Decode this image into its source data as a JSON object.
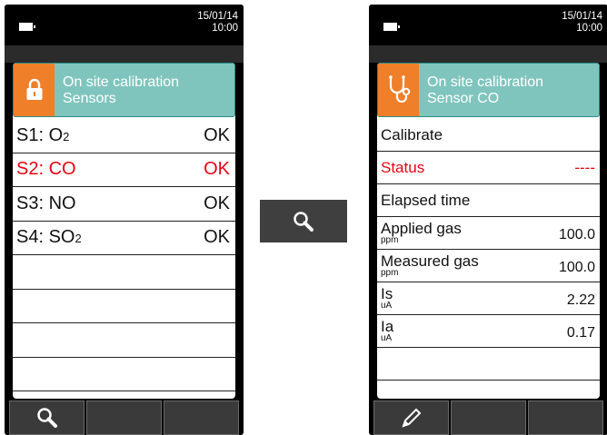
{
  "left_screen": {
    "date": "15/01/14",
    "time": "10:00",
    "header_line1": "On site calibration",
    "header_line2": "Sensors",
    "header_icon": "lock-icon",
    "sensors": [
      {
        "prefix": "S1: O",
        "sub": "2",
        "status": "OK",
        "highlighted": false
      },
      {
        "prefix": "S2: CO",
        "sub": "",
        "status": "OK",
        "highlighted": true
      },
      {
        "prefix": "S3: NO",
        "sub": "",
        "status": "OK",
        "highlighted": false
      },
      {
        "prefix": "S4: SO",
        "sub": "2",
        "status": "OK",
        "highlighted": false
      }
    ],
    "softkey_icons": [
      "search-icon",
      "",
      ""
    ]
  },
  "middle_button": {
    "icon": "search-icon"
  },
  "right_screen": {
    "date": "15/01/14",
    "time": "10:00",
    "header_line1": "On site calibration",
    "header_line2": "Sensor CO",
    "header_icon": "stethoscope-icon",
    "calibrate_label": "Calibrate",
    "status_label": "Status",
    "status_value": "----",
    "elapsed_label": "Elapsed time",
    "measurements": [
      {
        "label": "Applied gas",
        "unit": "ppm",
        "value": "100.0"
      },
      {
        "label": "Measured gas",
        "unit": "ppm",
        "value": "100.0"
      },
      {
        "label": "Is",
        "unit": "uA",
        "value": "2.22"
      },
      {
        "label": "Ia",
        "unit": "uA",
        "value": "0.17"
      }
    ],
    "softkey_icons": [
      "pencil-icon",
      "",
      ""
    ]
  },
  "colors": {
    "header_bg": "#7fc5bd",
    "icon_bg": "#ef7f29",
    "highlight_red": "#e30613",
    "softkey_bg": "#3a3a3a"
  }
}
